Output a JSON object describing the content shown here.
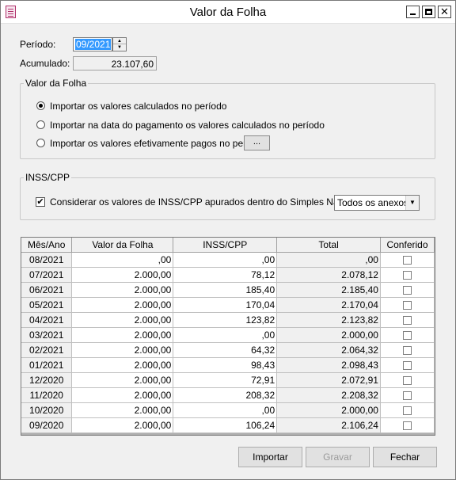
{
  "window": {
    "title": "Valor da Folha",
    "min_glyph": "",
    "max_glyph": "",
    "close_glyph": "✕"
  },
  "form": {
    "periodo_label": "Período:",
    "periodo_value": "09/2021",
    "acumulado_label": "Acumulado:",
    "acumulado_value": "23.107,60"
  },
  "valor_folha_group": {
    "title": "Valor da Folha",
    "options": [
      {
        "label": "Importar os valores calculados no período",
        "checked": true
      },
      {
        "label": "Importar na data do pagamento os valores calculados no período",
        "checked": false
      },
      {
        "label": "Importar os valores efetivamente pagos no período",
        "checked": false
      }
    ],
    "browse_label": "..."
  },
  "inss_group": {
    "title": "INSS/CPP",
    "checkbox_label": "Considerar os valores de INSS/CPP apurados dentro do Simples Nacional",
    "checkbox_checked": true,
    "check_glyph": "✔",
    "select_value": "Todos os anexos",
    "select_arrow": "▼"
  },
  "table": {
    "headers": [
      "Mês/Ano",
      "Valor da Folha",
      "INSS/CPP",
      "Total",
      "Conferido"
    ],
    "rows": [
      {
        "mes": "08/2021",
        "valor": ",00",
        "inss": ",00",
        "total": ",00",
        "conferido": false
      },
      {
        "mes": "07/2021",
        "valor": "2.000,00",
        "inss": "78,12",
        "total": "2.078,12",
        "conferido": false
      },
      {
        "mes": "06/2021",
        "valor": "2.000,00",
        "inss": "185,40",
        "total": "2.185,40",
        "conferido": false
      },
      {
        "mes": "05/2021",
        "valor": "2.000,00",
        "inss": "170,04",
        "total": "2.170,04",
        "conferido": false
      },
      {
        "mes": "04/2021",
        "valor": "2.000,00",
        "inss": "123,82",
        "total": "2.123,82",
        "conferido": false
      },
      {
        "mes": "03/2021",
        "valor": "2.000,00",
        "inss": ",00",
        "total": "2.000,00",
        "conferido": false
      },
      {
        "mes": "02/2021",
        "valor": "2.000,00",
        "inss": "64,32",
        "total": "2.064,32",
        "conferido": false
      },
      {
        "mes": "01/2021",
        "valor": "2.000,00",
        "inss": "98,43",
        "total": "2.098,43",
        "conferido": false
      },
      {
        "mes": "12/2020",
        "valor": "2.000,00",
        "inss": "72,91",
        "total": "2.072,91",
        "conferido": false
      },
      {
        "mes": "11/2020",
        "valor": "2.000,00",
        "inss": "208,32",
        "total": "2.208,32",
        "conferido": false
      },
      {
        "mes": "10/2020",
        "valor": "2.000,00",
        "inss": ",00",
        "total": "2.000,00",
        "conferido": false
      },
      {
        "mes": "09/2020",
        "valor": "2.000,00",
        "inss": "106,24",
        "total": "2.106,24",
        "conferido": false
      }
    ]
  },
  "buttons": {
    "importar": "Importar",
    "gravar": "Gravar",
    "gravar_enabled": false,
    "fechar": "Fechar"
  }
}
